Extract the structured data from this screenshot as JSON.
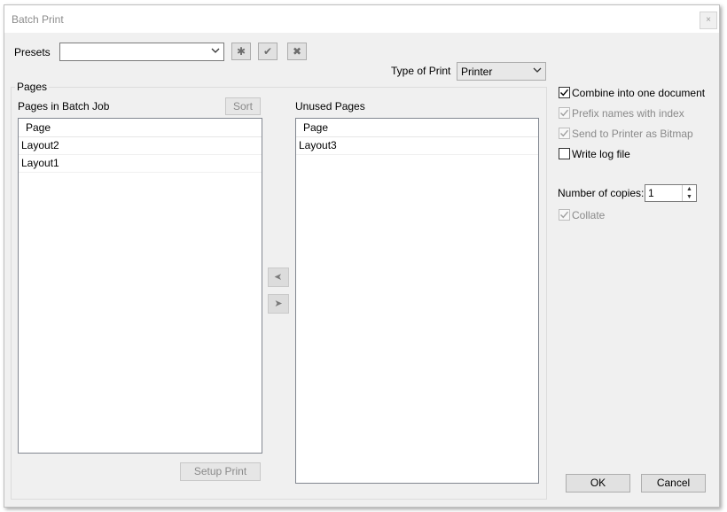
{
  "window": {
    "title": "Batch Print",
    "close_glyph": "×"
  },
  "presets": {
    "label": "Presets",
    "value": "",
    "buttons": [
      {
        "name": "new-preset-button",
        "icon": "asterisk-icon",
        "glyph": "✱"
      },
      {
        "name": "save-preset-button",
        "icon": "checkmark-icon",
        "glyph": "✔"
      },
      {
        "name": "delete-preset-button",
        "icon": "x-icon",
        "glyph": "✖"
      }
    ]
  },
  "type_of_print": {
    "label": "Type of Print",
    "value": "Printer"
  },
  "pages_group": {
    "title": "Pages"
  },
  "batch_list": {
    "label": "Pages in Batch Job",
    "sort_label": "Sort",
    "header": "Page",
    "rows": [
      "Layout2",
      "Layout1"
    ],
    "setup_label": "Setup Print"
  },
  "unused_list": {
    "label": "Unused Pages",
    "header": "Page",
    "rows": [
      "Layout3"
    ]
  },
  "move_buttons": {
    "left_glyph": "➤",
    "right_glyph": "➤"
  },
  "options": {
    "combine": {
      "label": "Combine into one document",
      "checked": true,
      "enabled": true
    },
    "prefix": {
      "label": "Prefix names with index",
      "checked": true,
      "enabled": false
    },
    "bitmap": {
      "label": "Send to Printer as Bitmap",
      "checked": true,
      "enabled": false
    },
    "log": {
      "label": "Write log file",
      "checked": false,
      "enabled": true
    },
    "copies_label": "Number of copies:",
    "copies_value": "1",
    "collate": {
      "label": "Collate",
      "checked": true,
      "enabled": false
    }
  },
  "footer": {
    "ok_label": "OK",
    "cancel_label": "Cancel"
  },
  "colors": {
    "window_bg": "#f0f0f0",
    "button_bg": "#e1e1e1",
    "disabled_text": "#8a8a8a"
  }
}
